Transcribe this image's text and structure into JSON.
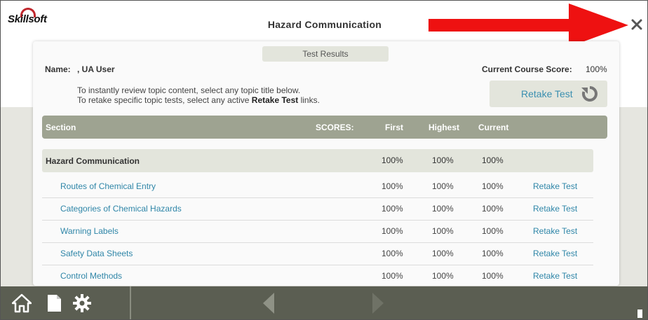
{
  "header": {
    "logo_text": "Skillsoft",
    "course_title": "Hazard Communication",
    "close_icon": "close-icon"
  },
  "panel": {
    "tab_title": "Test Results",
    "name_label": "Name:",
    "name_value": ", UA User",
    "course_score_label": "Current Course Score:",
    "course_score_value": "100%",
    "instruction_line1": "To instantly review topic content, select any topic title below.",
    "instruction_line2_prefix": "To retake specific topic tests, select any active ",
    "instruction_line2_bold": "Retake Test",
    "instruction_line2_suffix": " links.",
    "retake_button_label": "Retake Test",
    "retake_icon": "refresh-icon"
  },
  "table": {
    "headers": {
      "section": "Section",
      "scores": "SCORES:",
      "first": "First",
      "highest": "Highest",
      "current": "Current"
    },
    "group": {
      "name": "Hazard Communication",
      "first": "100%",
      "highest": "100%",
      "current": "100%"
    },
    "topics": [
      {
        "name": "Routes of Chemical Entry",
        "first": "100%",
        "highest": "100%",
        "current": "100%",
        "action": "Retake Test"
      },
      {
        "name": "Categories of Chemical Hazards",
        "first": "100%",
        "highest": "100%",
        "current": "100%",
        "action": "Retake Test"
      },
      {
        "name": "Warning Labels",
        "first": "100%",
        "highest": "100%",
        "current": "100%",
        "action": "Retake Test"
      },
      {
        "name": "Safety Data Sheets",
        "first": "100%",
        "highest": "100%",
        "current": "100%",
        "action": "Retake Test"
      },
      {
        "name": "Control Methods",
        "first": "100%",
        "highest": "100%",
        "current": "100%",
        "action": "Retake Test"
      }
    ]
  },
  "footer": {
    "icons": [
      "home-icon",
      "document-icon",
      "gear-icon",
      "back-arrow-icon",
      "forward-arrow-icon"
    ]
  },
  "colors": {
    "accent_link": "#2f86a8",
    "header_bar": "#9ea391",
    "footer_bar": "#5b5e52",
    "annotation_arrow": "#ee1111"
  }
}
